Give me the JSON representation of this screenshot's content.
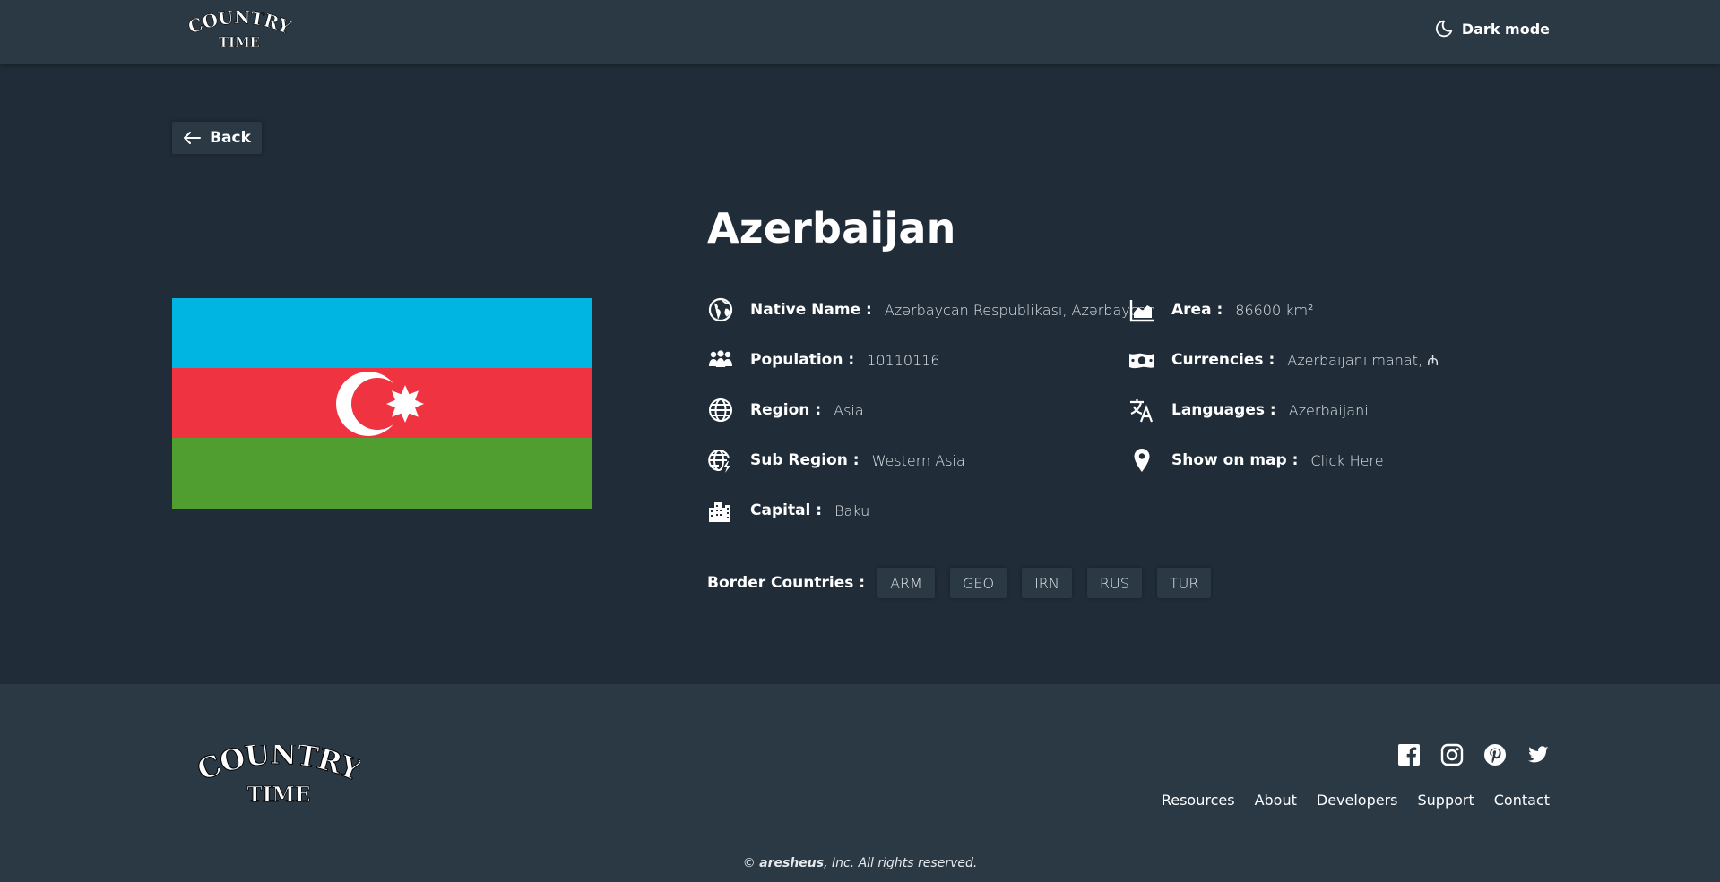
{
  "header": {
    "logo_line1": "COUNTRY",
    "logo_line2": "TIME",
    "dark_mode_label": "Dark mode",
    "dark_mode_icon": "moon-icon"
  },
  "back_button": {
    "label": "Back",
    "icon": "arrow-left-icon"
  },
  "country": {
    "name": "Azerbaijan",
    "flag_colors": {
      "top": "#00b5e2",
      "middle": "#ef3340",
      "bottom": "#509e2f",
      "emblem": "#ffffff"
    },
    "left_column": [
      {
        "icon": "globe-africa-icon",
        "label": "Native Name :",
        "value": "Azərbaycan Respublikası, Azərbaycan"
      },
      {
        "icon": "people-icon",
        "label": "Population :",
        "value": "10110116"
      },
      {
        "icon": "globe-icon",
        "label": "Region :",
        "value": "Asia"
      },
      {
        "icon": "globe-bolt-icon",
        "label": "Sub Region :",
        "value": "Western Asia"
      },
      {
        "icon": "city-icon",
        "label": "Capital :",
        "value": "Baku"
      }
    ],
    "right_column": [
      {
        "icon": "area-chart-icon",
        "label": "Area :",
        "value": "86600 km²"
      },
      {
        "icon": "money-icon",
        "label": "Currencies :",
        "value": "Azerbaijani manat, ₼"
      },
      {
        "icon": "translate-icon",
        "label": "Languages :",
        "value": "Azerbaijani"
      },
      {
        "icon": "map-pin-icon",
        "label": "Show on map :",
        "value": "Click Here"
      }
    ],
    "border_label": "Border Countries :",
    "borders": [
      "ARM",
      "GEO",
      "IRN",
      "RUS",
      "TUR"
    ]
  },
  "footer": {
    "logo_line1": "COUNTRY",
    "logo_line2": "TIME",
    "socials": [
      "facebook-icon",
      "instagram-icon",
      "pinterest-icon",
      "twitter-icon"
    ],
    "links": [
      "Resources",
      "About",
      "Developers",
      "Support",
      "Contact"
    ],
    "copyright_prefix": "© ",
    "copyright_name": "aresheus",
    "copyright_suffix": ", Inc. All rights reserved."
  },
  "colors": {
    "background": "#202c37",
    "elements": "#2b3945",
    "text": "#ffffff"
  }
}
